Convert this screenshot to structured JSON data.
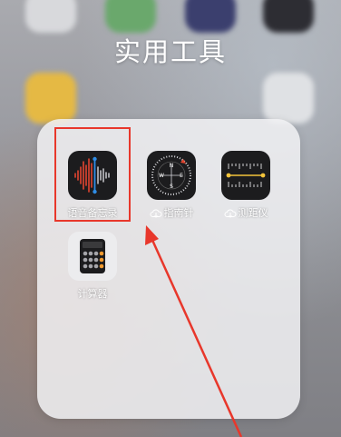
{
  "folder": {
    "title": "实用工具"
  },
  "apps": [
    {
      "label": "语音备忘录",
      "icon": "voice-memos-icon",
      "cloud": false
    },
    {
      "label": "指南针",
      "icon": "compass-icon",
      "cloud": true
    },
    {
      "label": "测距仪",
      "icon": "measure-icon",
      "cloud": true
    },
    {
      "label": "计算器",
      "icon": "calculator-icon",
      "cloud": false
    }
  ],
  "annotation": {
    "color": "#e8372b"
  },
  "colors": {
    "voice_red": "#e2452f",
    "voice_blue": "#2f8de6",
    "measure_yellow": "#f3c43b",
    "calc_orange": "#f29a2e"
  }
}
